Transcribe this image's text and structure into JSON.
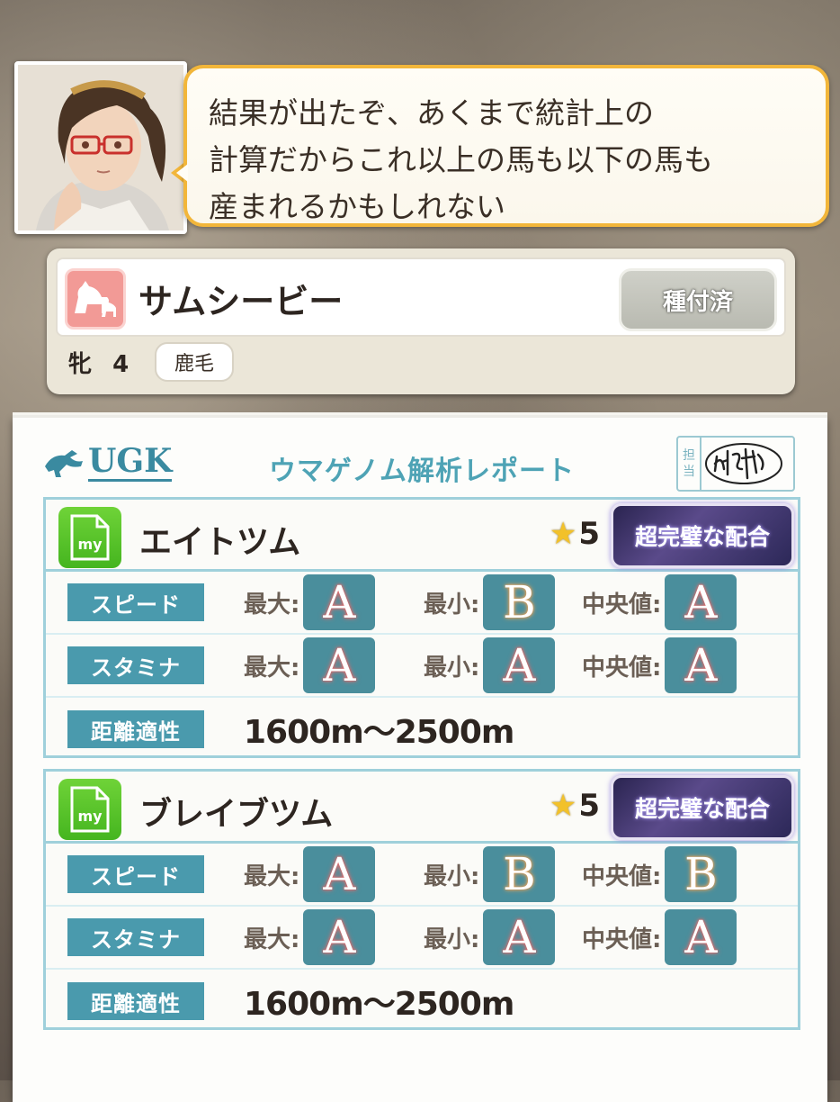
{
  "dialogue": {
    "lines": [
      "結果が出たぞ、あくまで統計上の",
      "計算だからこれ以上の馬も以下の馬も",
      "産まれるかもしれない"
    ]
  },
  "horse": {
    "name": "サムシービー",
    "bred_button": "種付済",
    "sex": "牝",
    "age": "4",
    "coat": "鹿毛"
  },
  "report": {
    "logo": "UGK",
    "title": "ウマゲノム解析レポート",
    "stamp_label": [
      "担",
      "当"
    ],
    "results": [
      {
        "name": "エイトツム",
        "stars": "5",
        "rank": "超完璧な配合",
        "speed": {
          "label": "スピード",
          "max": "A",
          "min": "B",
          "median": "A"
        },
        "stamina": {
          "label": "スタミナ",
          "max": "A",
          "min": "A",
          "median": "A"
        },
        "distance": {
          "label": "距離適性",
          "value": "1600m〜2500m"
        }
      },
      {
        "name": "ブレイブツム",
        "stars": "5",
        "rank": "超完璧な配合",
        "speed": {
          "label": "スピード",
          "max": "A",
          "min": "B",
          "median": "B"
        },
        "stamina": {
          "label": "スタミナ",
          "max": "A",
          "min": "A",
          "median": "A"
        },
        "distance": {
          "label": "距離適性",
          "value": "1600m〜2500m"
        }
      }
    ],
    "keys": {
      "max": "最大:",
      "min": "最小:",
      "median": "中央値:"
    },
    "my_icon_label": "my"
  }
}
